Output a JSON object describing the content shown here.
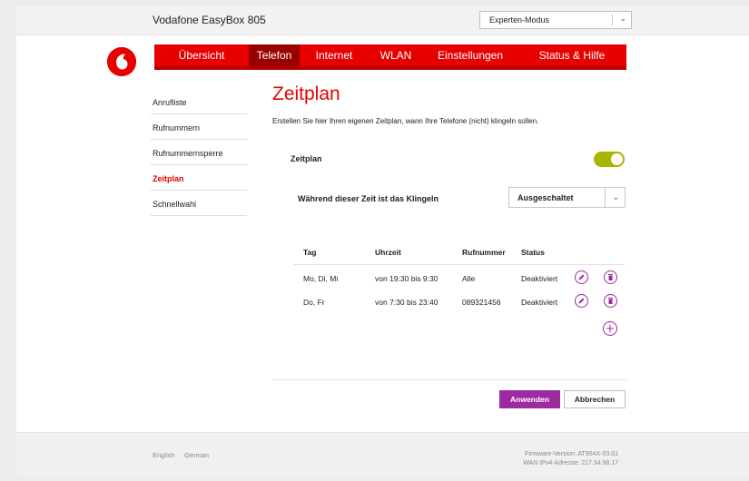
{
  "header": {
    "app_title": "Vodafone EasyBox 805",
    "mode_select": {
      "value": "Experten-Modus",
      "chevron_icon": "chevron-down-icon"
    }
  },
  "logo": {
    "icon": "vodafone-logo"
  },
  "nav": {
    "items": [
      {
        "label": "Übersicht",
        "active": false
      },
      {
        "label": "Telefon",
        "active": true
      },
      {
        "label": "Internet",
        "active": false
      },
      {
        "label": "WLAN",
        "active": false
      },
      {
        "label": "Einstellungen",
        "active": false
      },
      {
        "label": "Status & Hilfe",
        "active": false
      }
    ]
  },
  "sidebar": {
    "items": [
      {
        "label": "Anrufliste",
        "active": false
      },
      {
        "label": "Rufnummern",
        "active": false
      },
      {
        "label": "Rufnummernsperre",
        "active": false
      },
      {
        "label": "Zeitplan",
        "active": true
      },
      {
        "label": "Schnellwahl",
        "active": false
      }
    ]
  },
  "main": {
    "title": "Zeitplan",
    "description": "Erstellen Sie hier Ihren eigenen Zeitplan, wann Ihre Telefone (nicht) klingeln sollen.",
    "schedule_toggle": {
      "label": "Zeitplan",
      "on": true
    },
    "ringing": {
      "label": "Während dieser Zeit ist das Klingeln",
      "value": "Ausgeschaltet"
    },
    "table": {
      "columns": [
        "Tag",
        "Uhrzeit",
        "Rufnummer",
        "Status"
      ],
      "rows": [
        {
          "tag": "Mo, Di, Mi",
          "uhrzeit": "von 19:30 bis 9:30",
          "rufnummer": "Alle",
          "status": "Deaktiviert"
        },
        {
          "tag": "Do, Fr",
          "uhrzeit": "von 7:30 bis 23:40",
          "rufnummer": "089321456",
          "status": "Deaktiviert"
        }
      ]
    },
    "buttons": {
      "apply": "Anwenden",
      "cancel": "Abbrechen"
    }
  },
  "footer": {
    "languages": [
      "English",
      "German"
    ],
    "firmware": "Firmware-Version: AT904X-03.01",
    "wan": "WAN IPv4-Adresse: 217.34.98.17"
  },
  "colors": {
    "brand_red": "#e60000",
    "nav_active": "#990000",
    "accent_purple": "#9c2aa0",
    "toggle_on": "#a8b400"
  }
}
